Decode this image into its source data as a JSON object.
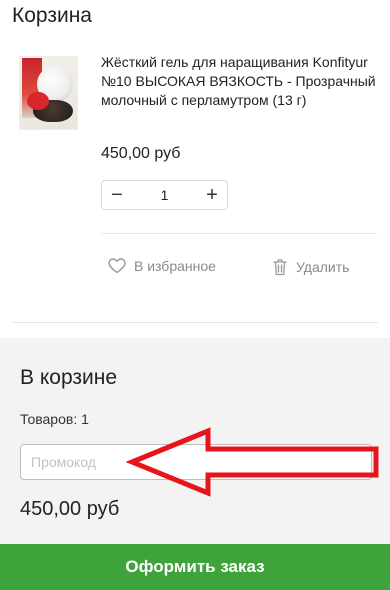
{
  "page": {
    "title": "Корзина"
  },
  "product": {
    "name": "Жёсткий гель для наращивания Konfityur №10 ВЫСОКАЯ ВЯЗКОСТЬ - Прозрачный молочный с перламутром (13 г)",
    "price": "450,00 руб",
    "quantity": "1",
    "decrement_symbol": "−",
    "increment_symbol": "+",
    "favorite_label": "В избранное",
    "delete_label": "Удалить",
    "favorite_icon": "heart-icon",
    "delete_icon": "trash-icon"
  },
  "summary": {
    "title": "В корзине",
    "items_count": "Товаров: 1",
    "promo_placeholder": "Промокод",
    "promo_value": "",
    "total": "450,00 руб",
    "checkout_label": "Оформить заказ"
  },
  "colors": {
    "checkout_bg": "#3fa33b",
    "annotation_arrow": "#e8141c",
    "summary_bg": "#f3f3f3"
  }
}
